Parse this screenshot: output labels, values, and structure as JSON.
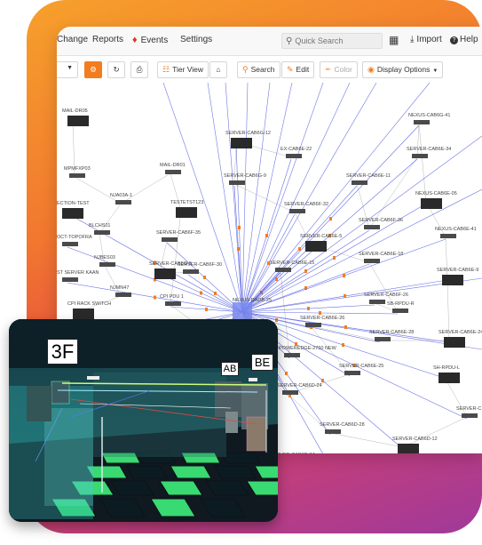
{
  "menu": {
    "items": [
      {
        "label": "Change"
      },
      {
        "label": "Reports"
      },
      {
        "label": "Events"
      },
      {
        "label": "Settings"
      }
    ],
    "search_placeholder": "Quick Search",
    "import_label": "Import",
    "help_label": "Help"
  },
  "toolbar": {
    "tier_view": "Tier View",
    "search": "Search",
    "edit": "Edit",
    "color": "Color",
    "display_options": "Display Options"
  },
  "graph": {
    "hub_label": "NEXUS-DADB-25",
    "nodes": [
      {
        "label": "MAIL-DR05"
      },
      {
        "label": "MPMFXP03"
      },
      {
        "label": "MAIL-DR01"
      },
      {
        "label": "NJA03A-1"
      },
      {
        "label": "TESTETST123"
      },
      {
        "label": "BLCHS01"
      },
      {
        "label": "NJBES03"
      },
      {
        "label": "NJMN47"
      },
      {
        "label": "CPI RACK SWITCH"
      },
      {
        "label": "CPI PDU 1"
      },
      {
        "label": "PROLIANT 1"
      },
      {
        "label": "UCS 5108 7G-SRU"
      },
      {
        "label": "SERVER-CAB6G-12"
      },
      {
        "label": "SERVER-CAB6G-9"
      },
      {
        "label": "SERVER-CAB6F-35"
      },
      {
        "label": "SERVER-CAB6F-30"
      },
      {
        "label": "SERVER-CAB6G-5"
      },
      {
        "label": "SERVER-CAB6F-36"
      },
      {
        "label": "SERVER-CAB6F-32"
      },
      {
        "label": "SERVER-CAB6E-15"
      },
      {
        "label": "SERVER-CAB6E-5"
      },
      {
        "label": "SERVER-CAB6E-18"
      },
      {
        "label": "SERVER-CAB6E-26"
      },
      {
        "label": "SERVER-CAB6E-28"
      },
      {
        "label": "SERVER-CAB6E-24"
      },
      {
        "label": "SERVER-CAB6E-25"
      },
      {
        "label": "SERVER-CAB6E-34"
      },
      {
        "label": "SERVER-CAB6E-11"
      },
      {
        "label": "SERVER-CAB6E-9"
      },
      {
        "label": "SERVER-CAB6D-24"
      },
      {
        "label": "SERVER-CAB6D-28"
      },
      {
        "label": "SERVER-CAB6D-18"
      },
      {
        "label": "SERVER-CAB6D-12"
      },
      {
        "label": "SERVER-CAB6D-34"
      },
      {
        "label": "SERVER-CAB6F-26"
      },
      {
        "label": "NEXUS-CAB6G-41"
      },
      {
        "label": "NEXUS-CAB6E-05"
      },
      {
        "label": "NEXUS-CAB6E-41"
      },
      {
        "label": "EX-CAB6E-22"
      },
      {
        "label": "SB-RPDU-R"
      },
      {
        "label": "SH-RPDU-L"
      },
      {
        "label": "POWEREDGE-2750 NEW"
      },
      {
        "label": "ST SERVER KAAN"
      },
      {
        "label": "OCT-TOPOFRA"
      },
      {
        "label": "ECTION-TEST"
      },
      {
        "label": "SERVER-C"
      }
    ]
  },
  "inset": {
    "floor_badge": "3F",
    "zone_ab": "AB",
    "zone_be": "BE"
  },
  "colors": {
    "accent_orange": "#f47c20",
    "link_blue": "#4a56e0",
    "floor_green": "#3ef07a",
    "gradient_top": "#f6a02b",
    "gradient_bottom": "#a0399a"
  }
}
